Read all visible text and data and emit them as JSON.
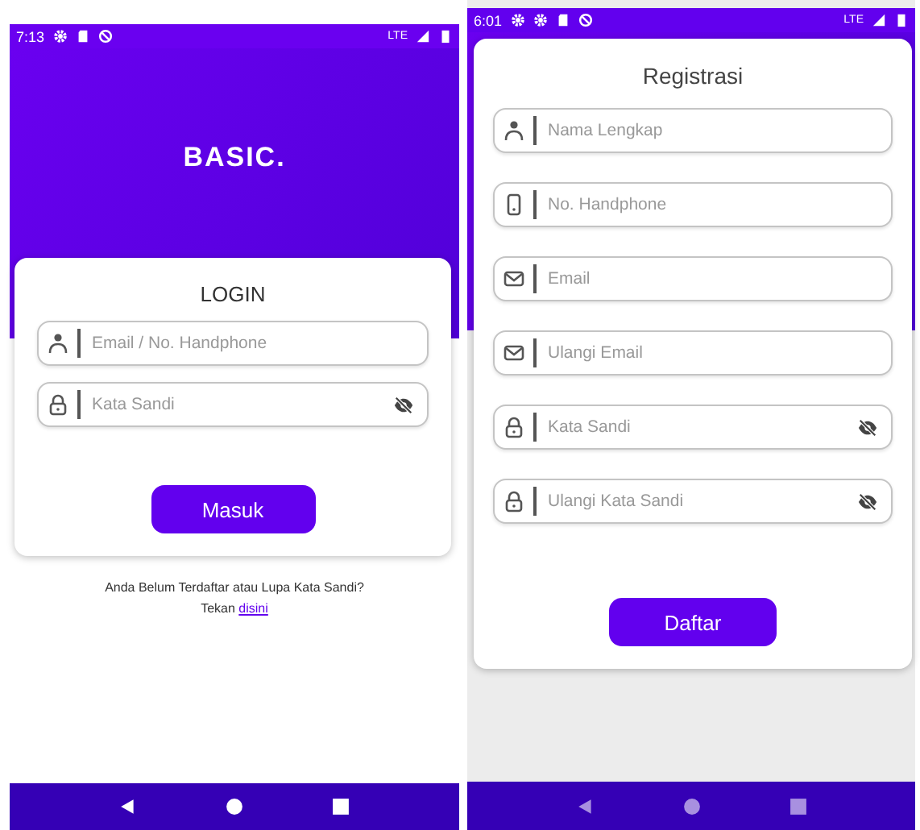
{
  "screens": [
    {
      "kind": "login",
      "status_bar": {
        "time": "7:13",
        "icons": [
          {
            "kind": "gear"
          },
          {
            "kind": "sdcard"
          },
          {
            "kind": "blocked"
          }
        ],
        "network": "LTE"
      },
      "header": {
        "brand": "BASIC."
      },
      "card": {
        "title": "LOGIN",
        "fields": [
          {
            "kind": "person",
            "placeholder": "Email / No. Handphone",
            "visibility_toggle": false
          },
          {
            "kind": "lock",
            "placeholder": "Kata Sandi",
            "visibility_toggle": true
          }
        ],
        "button": "Masuk"
      },
      "footer": {
        "text": "Anda Belum Terdaftar atau Lupa Kata Sandi?",
        "text2": "Tekan",
        "link": "disini"
      },
      "nav_dimmed": false
    },
    {
      "kind": "register",
      "status_bar": {
        "time": "6:01",
        "icons": [
          {
            "kind": "gear"
          },
          {
            "kind": "gear"
          },
          {
            "kind": "sdcard"
          },
          {
            "kind": "blocked"
          }
        ],
        "network": "LTE"
      },
      "card": {
        "title": "Registrasi",
        "fields": [
          {
            "kind": "person",
            "placeholder": "Nama Lengkap",
            "visibility_toggle": false
          },
          {
            "kind": "phone",
            "placeholder": "No. Handphone",
            "visibility_toggle": false
          },
          {
            "kind": "mail",
            "placeholder": "Email",
            "visibility_toggle": false
          },
          {
            "kind": "mail",
            "placeholder": "Ulangi Email",
            "visibility_toggle": false
          },
          {
            "kind": "lock",
            "placeholder": "Kata Sandi",
            "visibility_toggle": true
          },
          {
            "kind": "lock",
            "placeholder": "Ulangi Kata Sandi",
            "visibility_toggle": true
          }
        ],
        "button": "Daftar"
      },
      "nav_dimmed": true
    }
  ]
}
